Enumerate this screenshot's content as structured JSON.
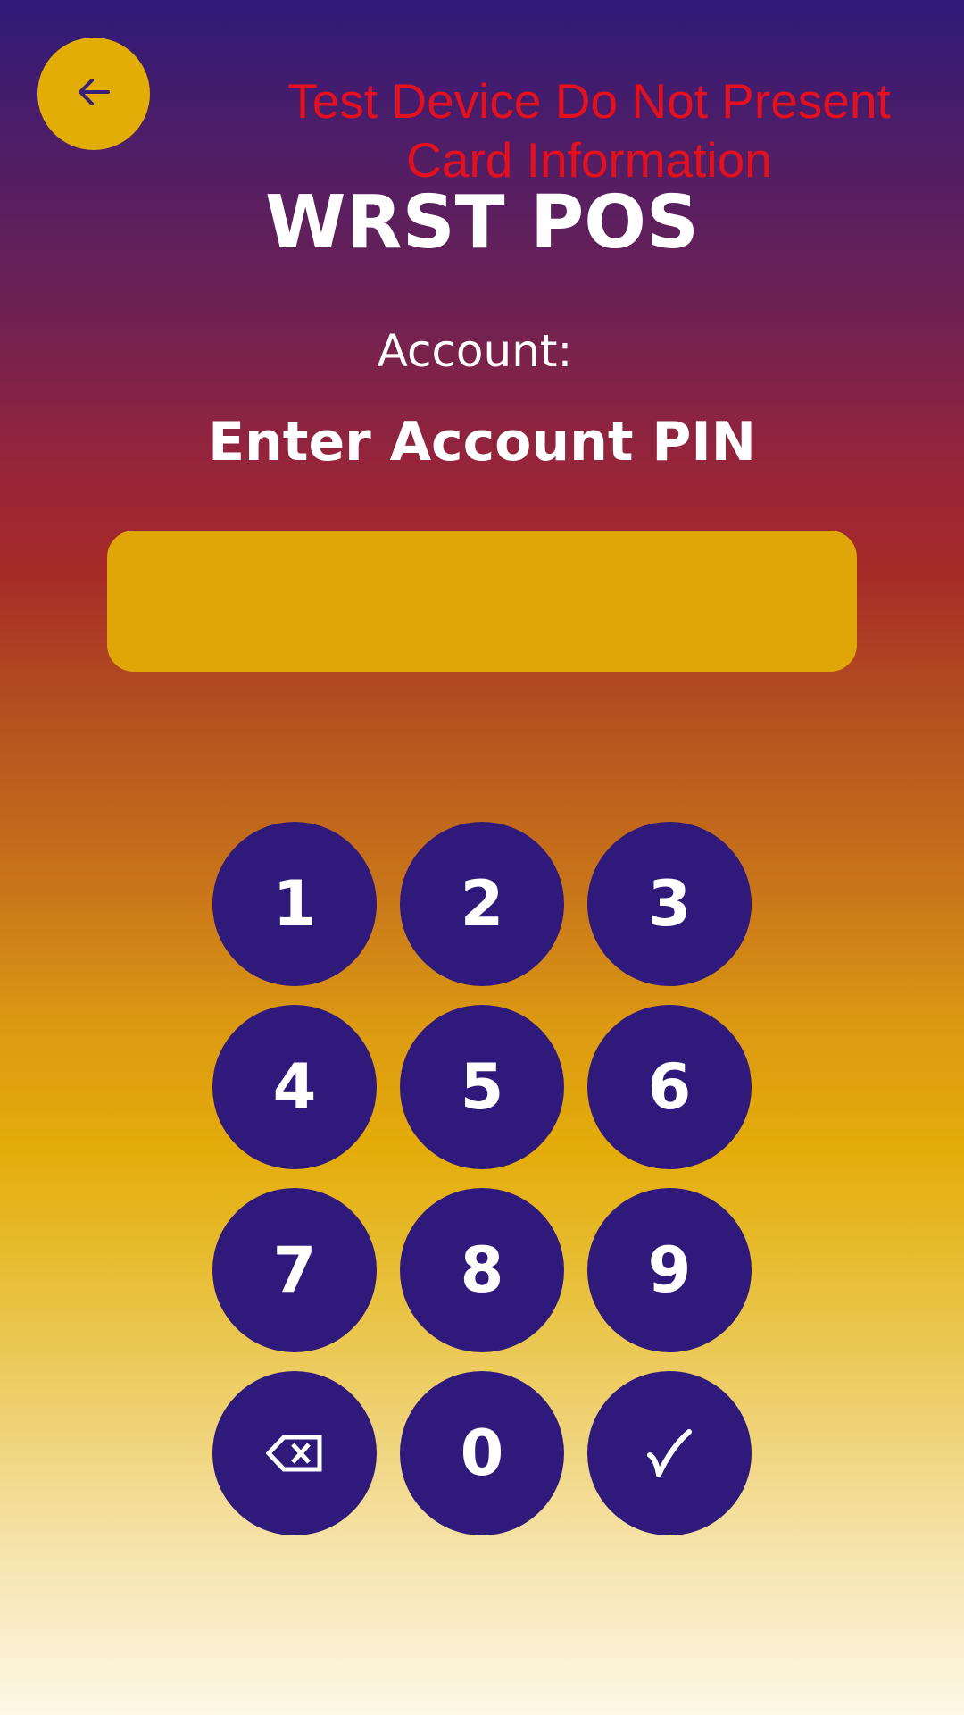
{
  "header": {
    "back_icon": "arrow-left-icon",
    "warning_text": "Test Device Do Not Present Card Information",
    "app_title": "WRST POS"
  },
  "form": {
    "account_label": "Account:",
    "prompt": "Enter Account PIN",
    "pin_value": ""
  },
  "keypad": {
    "keys": [
      "1",
      "2",
      "3",
      "4",
      "5",
      "6",
      "7",
      "8",
      "9"
    ],
    "zero": "0",
    "backspace_icon": "backspace-icon",
    "confirm_icon": "checkmark-icon"
  },
  "colors": {
    "accent_gold": "#e1ad06",
    "key_purple": "#2f197a",
    "warning_red": "#e5101e",
    "gradient_top": "#2e1a78",
    "gradient_bottom": "#fdf7e6"
  }
}
